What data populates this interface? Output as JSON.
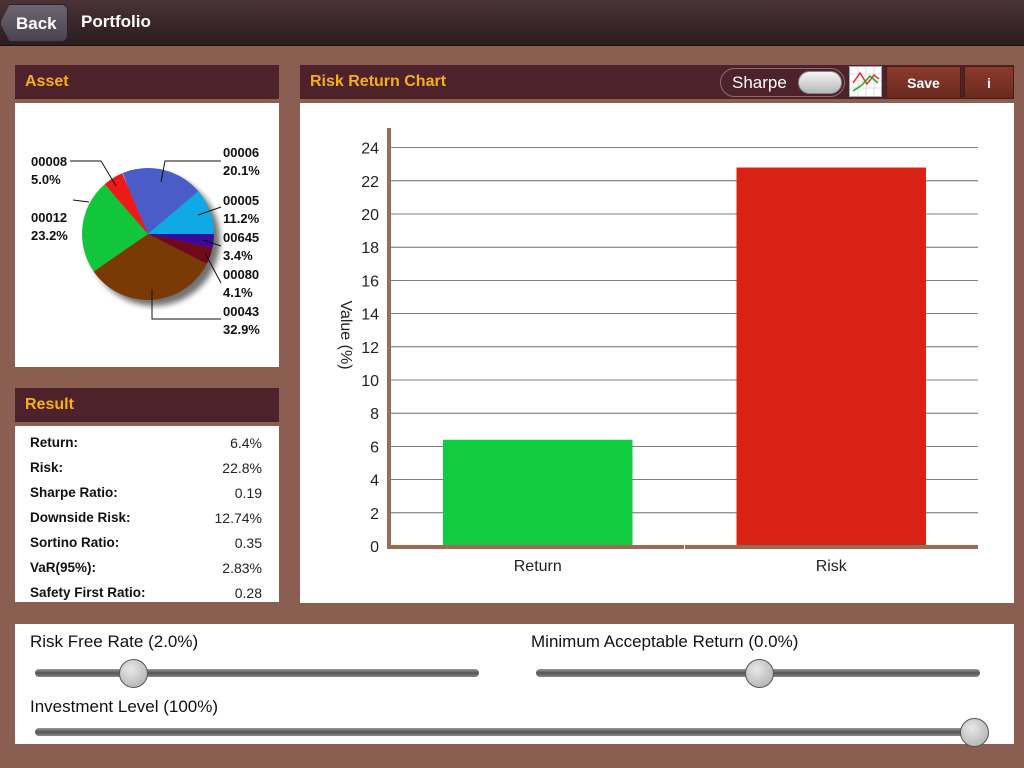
{
  "navbar": {
    "back_label": "Back",
    "title": "Portfolio"
  },
  "asset_panel": {
    "title": "Asset",
    "slices": [
      {
        "id": "00006",
        "pct": 20.1,
        "label_pct": "20.1%",
        "color": "#4a5cc8"
      },
      {
        "id": "00005",
        "pct": 11.2,
        "label_pct": "11.2%",
        "color": "#11a8e6"
      },
      {
        "id": "00645",
        "pct": 3.4,
        "label_pct": "3.4%",
        "color": "#3a0a9a"
      },
      {
        "id": "00080",
        "pct": 4.1,
        "label_pct": "4.1%",
        "color": "#6e0a1a"
      },
      {
        "id": "00043",
        "pct": 32.9,
        "label_pct": "32.9%",
        "color": "#7a3a06"
      },
      {
        "id": "00012",
        "pct": 23.2,
        "label_pct": "23.2%",
        "color": "#11c63a"
      },
      {
        "id": "00008",
        "pct": 5.0,
        "label_pct": "5.0%",
        "color": "#ee1a1a"
      }
    ]
  },
  "result_panel": {
    "title": "Result",
    "rows": [
      {
        "label": "Return:",
        "value": "6.4%"
      },
      {
        "label": "Risk:",
        "value": "22.8%"
      },
      {
        "label": "Sharpe Ratio:",
        "value": "0.19"
      },
      {
        "label": "Downside Risk:",
        "value": "12.74%"
      },
      {
        "label": "Sortino Ratio:",
        "value": "0.35"
      },
      {
        "label": "VaR(95%):",
        "value": "2.83%"
      },
      {
        "label": "Safety First Ratio:",
        "value": "0.28"
      }
    ]
  },
  "chart_panel": {
    "title": "Risk Return Chart",
    "sharpe_toggle_label": "Sharpe",
    "sharpe_toggle_on": false,
    "save_label": "Save",
    "info_label": "i"
  },
  "chart_data": {
    "type": "bar",
    "title": "Risk Return Chart",
    "categories": [
      "Return",
      "Risk"
    ],
    "values": [
      6.4,
      22.8
    ],
    "colors": [
      "#11cc3e",
      "#d82314"
    ],
    "xlabel": "",
    "ylabel": "Value (%)",
    "ylim": [
      0,
      25
    ],
    "yticks": [
      0,
      2,
      4,
      6,
      8,
      10,
      12,
      14,
      16,
      18,
      20,
      22,
      24
    ],
    "grid": true
  },
  "controls": {
    "risk_free_rate": {
      "label": "Risk Free Rate (2.0%)",
      "fraction": 0.2
    },
    "min_acceptable_return": {
      "label": "Minimum Acceptable Return (0.0%)",
      "fraction": 0.5
    },
    "investment_level": {
      "label": "Investment Level (100%)",
      "fraction": 1.0
    }
  }
}
